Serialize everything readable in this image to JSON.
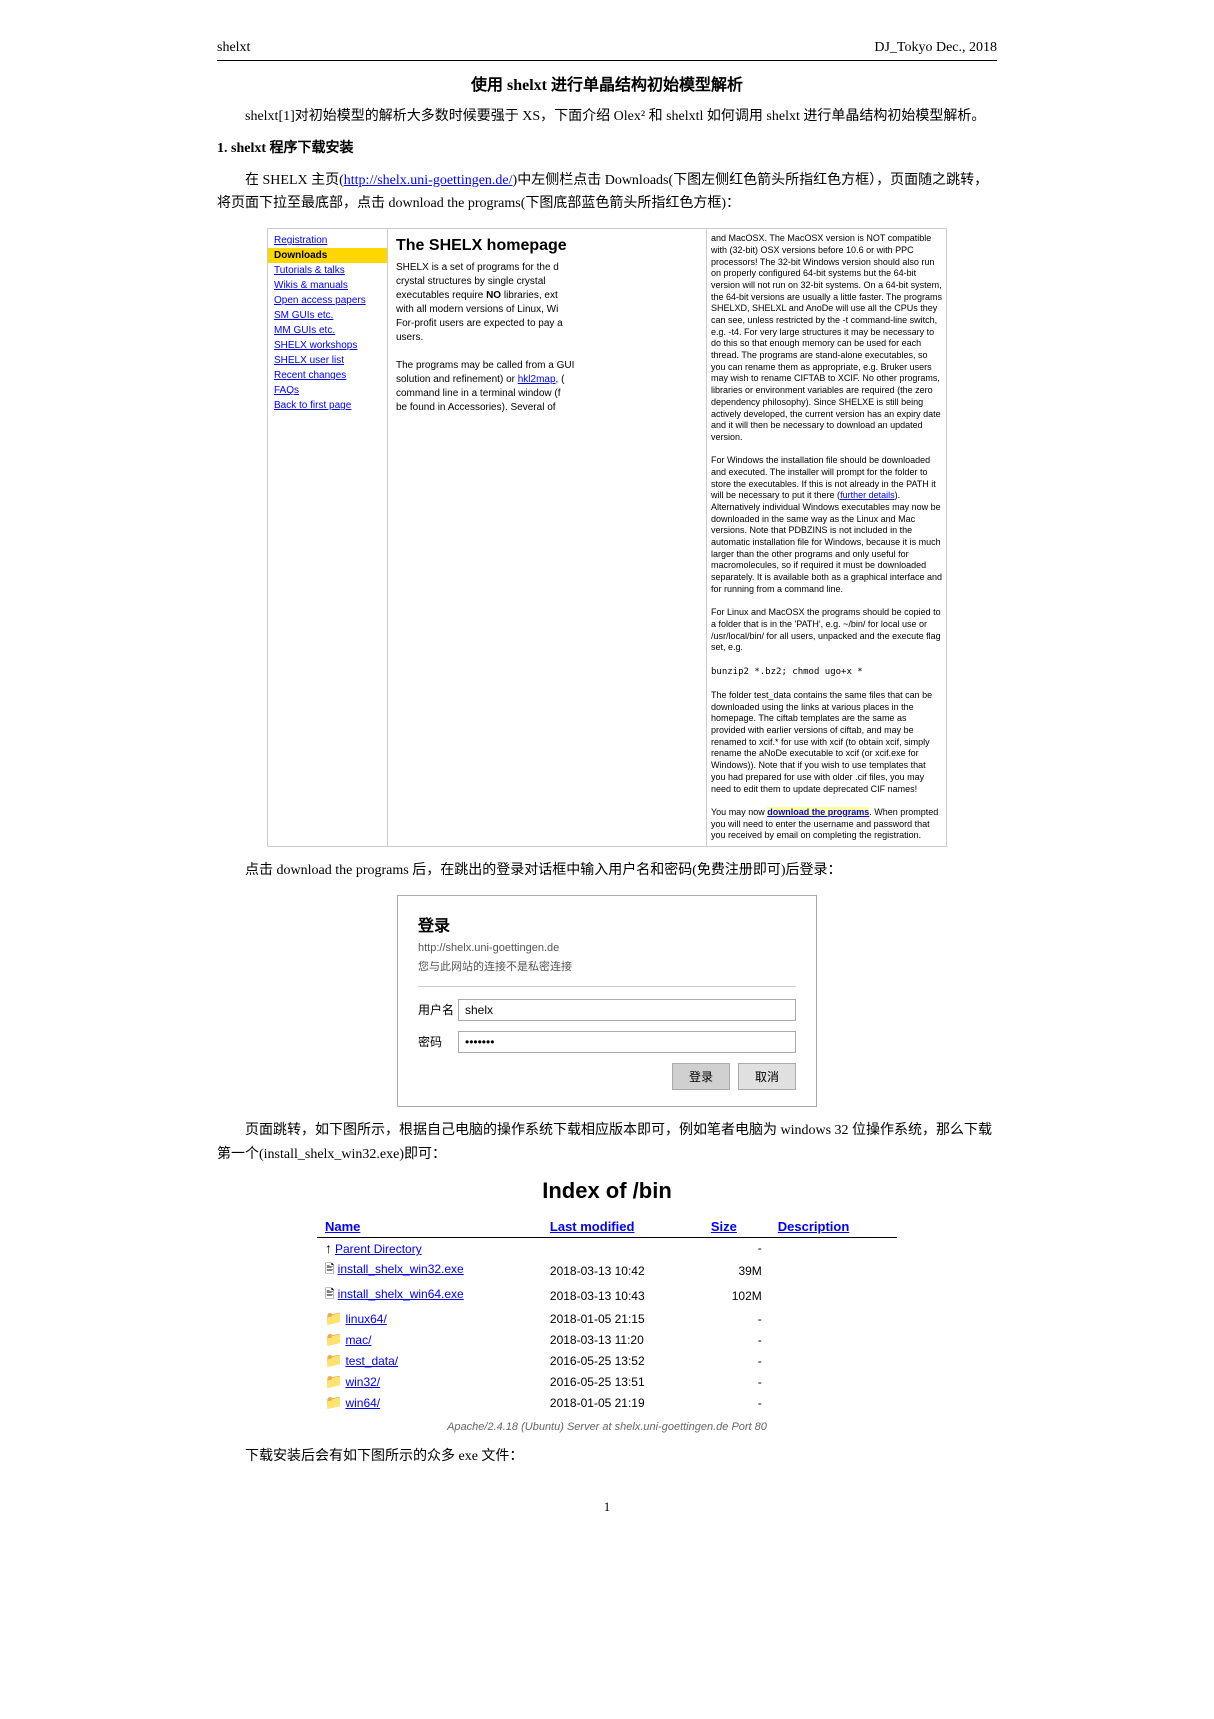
{
  "header": {
    "left": "shelxt",
    "center": "",
    "right": "DJ_Tokyo                    Dec., 2018"
  },
  "title": "使用 shelxt 进行单晶结构初始模型解析",
  "intro_paragraph": "shelxt[1]对初始模型的解析大多数时候要强于 XS，下面介绍 Olex² 和 shelxtl 如何调用 shelxt 进行单晶结构初始模型解析。",
  "section1_heading": "1. shelxt 程序下载安装",
  "section1_para": "在 SHELX 主页(http://shelx.uni-goettingen.de/)中左侧栏点击 Downloads(下图左侧红色箭头所指红色方框），页面随之跳转，将页面下拉至最底部，点击 download the programs(下图底部蓝色箭头所指红色方框)：",
  "shelx_website": {
    "sidebar_items": [
      {
        "label": "Registration",
        "active": false
      },
      {
        "label": "Downloads",
        "active": true
      },
      {
        "label": "Tutorials & talks",
        "active": false
      },
      {
        "label": "Wikis & manuals",
        "active": false
      },
      {
        "label": "Open access papers",
        "active": false
      },
      {
        "label": "SM GUIs etc.",
        "active": false
      },
      {
        "label": "MM GUIs etc.",
        "active": false
      },
      {
        "label": "SHELX workshops",
        "active": false
      },
      {
        "label": "SHELX user list",
        "active": false
      },
      {
        "label": "Recent changes",
        "active": false
      },
      {
        "label": "FAQs",
        "active": false
      },
      {
        "label": "Back to first page",
        "active": false
      }
    ],
    "main_title": "The SHELX homepage",
    "main_text": "SHELX is a set of programs for the determination of small and macromolecular crystal structures by single crystal X-ray and neutron diffraction. The executables require NO libraries, external programs or environment variables, and are compatible with all modern versions of Linux, Windows and MacOSX. For-profit users are expected to pay a license fee to Bruker AXS if using SHELX for commercial purposes.\n\nThe programs may be called from a GUI (e.g. ShelXle or OLEX2 for solution and refinement) or hkl2map for Patterson methods. Help may be obtained from a terminal window (for SHELXS and SHELXD) or command line in a terminal window (for SHELXL and SHELXE) by typing the program name without any parameters. Tutorials may be found in Accessories). Several of",
    "right_text": "and MacOSX. The MacOSX version is NOT compatible with (32-bit) OSX versions before 10.6 or with PPC processors! The 32-bit Windows version should also run on properly configured 64-bit systems but the 64-bit version will not run on 32-bit systems. On a 64-bit system, the 64-bit versions are usually a little faster. The programs SHELXD, SHELXL and AnoDe will use all the CPUs they can see, unless restricted by the -t command-line switch, e.g. -t4. For very large structures it may be necessary to do this so that enough memory can be used for each thread. The programs are stand-alone executables, so you can rename them as appropriate, e.g. Bruker users may wish to rename CIFTAB to XCIF. No other programs, libraries or environment variables are required (the zero dependency philosophy). Since SHELXE is still being actively developed, the current version has an expiry date and it will then be necessary to download an updated version.\n\nFor Windows the installation file should be downloaded and executed. The installer will prompt for the folder to store the executables. If this is not already in the PATH it will be necessary to put it there (further details). Alternatively individual Windows executables may now be downloaded in the same way as the Linux and Mac versions. Note that PDBZINS is not included in the automatic installation file for Windows, because it is much larger than the other programs and only useful for macromolecules, so if required it must be downloaded separately. It is available both as a graphical interface and for running from a command line.\n\nFor Linux and MacOSX the programs should be copied to a folder that is in the 'PATH', e.g. ~/bin/ for local use or /usr/local/bin/ for all users, unpacked and the execute flag set, e.g.\n\nbunzip2 *.bz2; chmod ugo+x *\n\nThe folder test_data contains the same files that can be downloaded using the links at various places in the homepage. The ciftab templates are the same as provided with earlier versions of ciftab, and may be renamed to xcif.* for use with xcif (to obtain xcif, simply rename the aNoDe executable to xcif (or xcif.exe for Windows)). Note that if you wish to use templates that you had prepared for use with older .cif files, you may need to edit them to update deprecated CIF names!\n\nYou may now download the programs. When prompted you will need to enter the username and password that you received by email on completing the registration."
  },
  "after_download_text": "点击 download the programs 后，在跳出的登录对话框中输入用户名和密码(免费注册即可)后登录：",
  "login_dialog": {
    "title": "登录",
    "subtitle": "http://shelx.uni-goettingen.de",
    "warning": "您与此网站的连接不是私密连接",
    "username_label": "用户名",
    "username_value": "shelx",
    "password_label": "密码",
    "password_value": "•••••••",
    "login_btn": "登录",
    "cancel_btn": "取消"
  },
  "after_login_text": "页面跳转，如下图所示，根据自己电脑的操作系统下载相应版本即可，例如笔者电脑为 windows 32 位操作系统，那么下载第一个(install_shelx_win32.exe)即可：",
  "index_section": {
    "title": "Index of /bin",
    "columns": [
      "Name",
      "Last modified",
      "Size",
      "Description"
    ],
    "rows": [
      {
        "icon": "parent",
        "name": "Parent Directory",
        "modified": "",
        "size": "-",
        "description": ""
      },
      {
        "icon": "exe",
        "name": "install_shelx_win32.exe",
        "modified": "2018-03-13 10:42",
        "size": "39M",
        "description": ""
      },
      {
        "icon": "exe",
        "name": "install_shelx_win64.exe",
        "modified": "2018-03-13 10:43",
        "size": "102M",
        "description": ""
      },
      {
        "icon": "folder",
        "name": "linux64/",
        "modified": "2018-01-05 21:15",
        "size": "-",
        "description": ""
      },
      {
        "icon": "folder",
        "name": "mac/",
        "modified": "2018-03-13 11:20",
        "size": "-",
        "description": ""
      },
      {
        "icon": "folder",
        "name": "test_data/",
        "modified": "2016-05-25 13:52",
        "size": "-",
        "description": ""
      },
      {
        "icon": "folder",
        "name": "win32/",
        "modified": "2016-05-25 13:51",
        "size": "-",
        "description": ""
      },
      {
        "icon": "folder",
        "name": "win64/",
        "modified": "2018-01-05 21:19",
        "size": "-",
        "description": ""
      }
    ],
    "footer": "Apache/2.4.18 (Ubuntu) Server at shelx.uni-goettingen.de Port 80"
  },
  "final_text": "下载安装后会有如下图所示的众多 exe 文件：",
  "page_number": "1"
}
